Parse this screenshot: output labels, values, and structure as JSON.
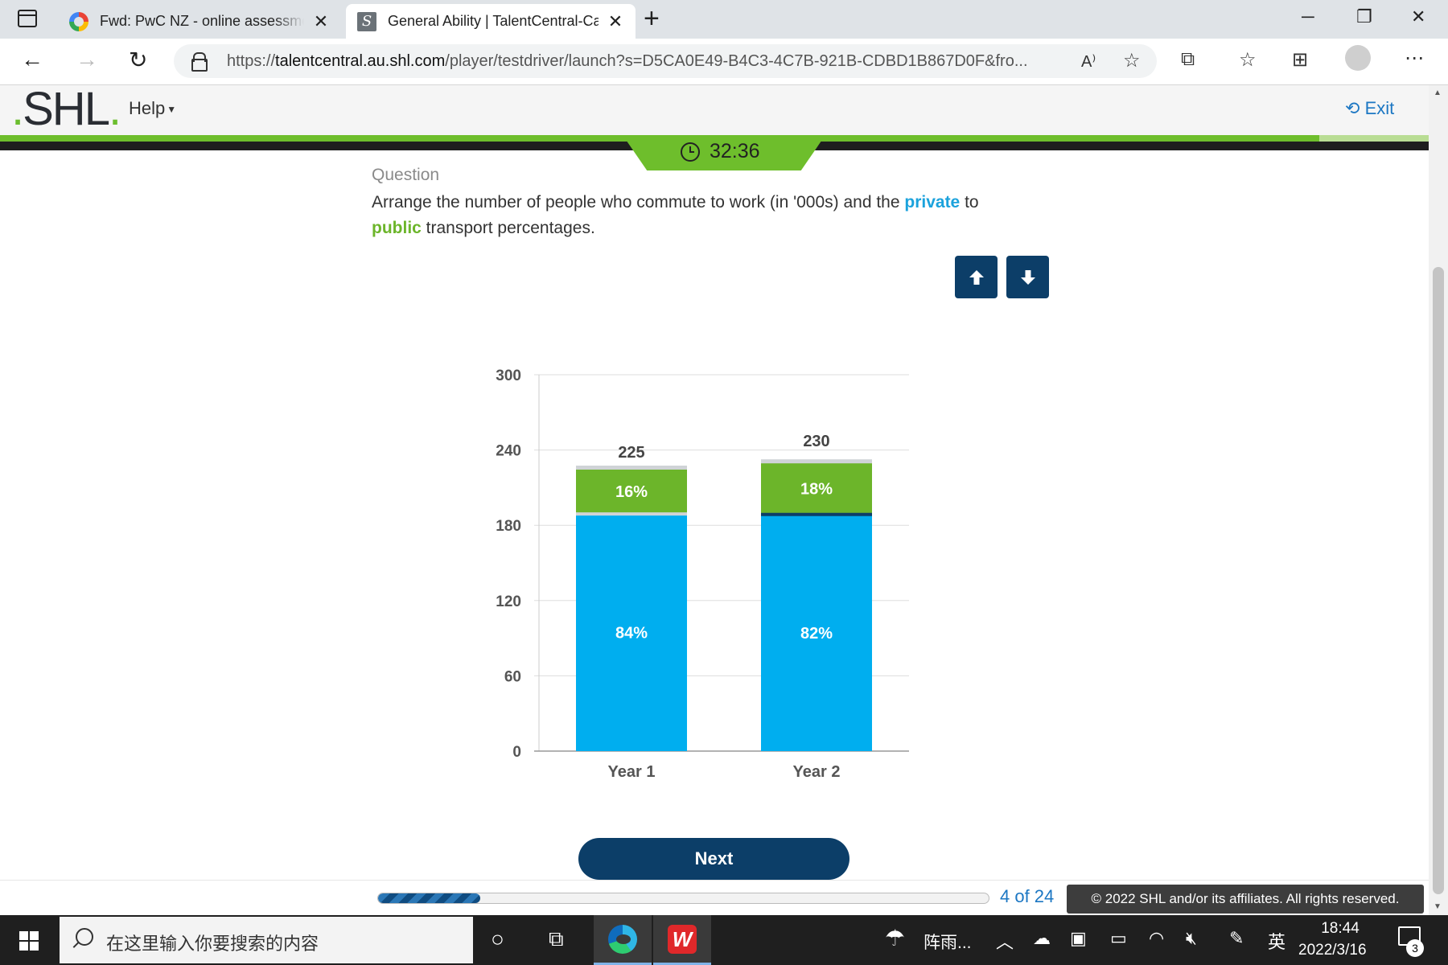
{
  "browser": {
    "tabs": [
      {
        "title": "Fwd: PwC NZ - online assessment",
        "active": false,
        "favicon": "gmail-icon"
      },
      {
        "title": "General Ability | TalentCentral-Ca",
        "active": true,
        "favicon": "shl-icon"
      }
    ],
    "url_prefix": "https://",
    "url_host": "talentcentral.au.shl.com",
    "url_rest": "/player/testdriver/launch?s=D5CA0E49-B4C3-4C7B-921B-CDBD1B867D0F&fro..."
  },
  "header": {
    "logo_text": "SHL",
    "help_label": "Help",
    "exit_label": "Exit",
    "timer": "32:36"
  },
  "question": {
    "label": "Question",
    "text_before": "Arrange the number of people who commute to work (in '000s) and the ",
    "kw_private": "private",
    "text_mid": " to ",
    "kw_public": "public",
    "text_after": " transport percentages."
  },
  "chart_data": {
    "type": "bar",
    "stacked": true,
    "categories": [
      "Year 1",
      "Year 2"
    ],
    "totals": [
      225,
      230
    ],
    "series": [
      {
        "values": [
          189,
          188.6
        ],
        "percent_labels": [
          "84%",
          "82%"
        ],
        "color": "#00aeef"
      },
      {
        "values": [
          36,
          41.4
        ],
        "percent_labels": [
          "16%",
          "18%"
        ],
        "color": "#6cb52a"
      }
    ],
    "yticks": [
      0,
      60,
      120,
      180,
      240,
      300
    ],
    "ylim": [
      0,
      300
    ],
    "grid": true
  },
  "navigation": {
    "next_label": "Next",
    "progress_text": "4 of 24",
    "progress_fraction": 0.1667,
    "copyright": "© 2022 SHL and/or its affiliates. All rights reserved."
  },
  "taskbar": {
    "search_placeholder": "在这里输入你要搜索的内容",
    "weather": "阵雨...",
    "ime": "英",
    "time": "18:44",
    "date": "2022/3/16",
    "notifications": "3"
  }
}
